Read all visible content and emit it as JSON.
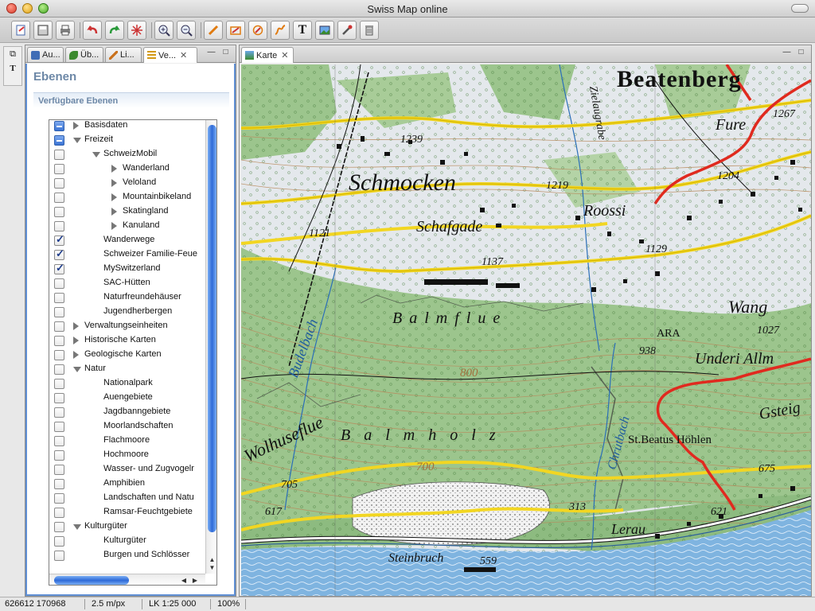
{
  "window": {
    "title": "Swiss Map online"
  },
  "toolbar": {
    "buttons": [
      {
        "name": "export-icon"
      },
      {
        "name": "save-icon"
      },
      {
        "name": "print-icon"
      },
      {
        "name": "undo-icon"
      },
      {
        "name": "redo-icon"
      },
      {
        "name": "center-icon"
      },
      {
        "name": "zoom-in-icon"
      },
      {
        "name": "zoom-out-icon"
      },
      {
        "name": "draw-line-icon"
      },
      {
        "name": "draw-polygon-icon"
      },
      {
        "name": "draw-circle-icon"
      },
      {
        "name": "draw-route-icon"
      },
      {
        "name": "text-icon"
      },
      {
        "name": "image-icon"
      },
      {
        "name": "tools-icon"
      },
      {
        "name": "trash-icon"
      }
    ],
    "text_button_label": "T"
  },
  "rail": {
    "icon1": "⧉",
    "icon2": "T"
  },
  "left_panel": {
    "tabs": [
      {
        "label": "Au...",
        "icon": "layers-tab-icon",
        "color": "#3f6db6"
      },
      {
        "label": "Üb...",
        "icon": "leaf-tab-icon",
        "color": "#3b8a2e"
      },
      {
        "label": "Li...",
        "icon": "pencil-tab-icon",
        "color": "#c9711c"
      },
      {
        "label": "Ve...",
        "icon": "list-tab-icon",
        "color": "#d39a16",
        "active": true
      }
    ],
    "close_glyph": "✕",
    "minimize_glyph": "—",
    "maximize_glyph": "□",
    "title": "Ebenen",
    "section": "Verfügbare Ebenen",
    "tree": [
      {
        "label": "Basisdaten",
        "level": 0,
        "check": "partial",
        "arrow": "right"
      },
      {
        "label": "Freizeit",
        "level": 0,
        "check": "partial",
        "arrow": "down"
      },
      {
        "label": "SchweizMobil",
        "level": 1,
        "check": "none",
        "arrow": "down"
      },
      {
        "label": "Wanderland",
        "level": 2,
        "check": "none",
        "arrow": "right"
      },
      {
        "label": "Veloland",
        "level": 2,
        "check": "none",
        "arrow": "right"
      },
      {
        "label": "Mountainbikeland",
        "level": 2,
        "check": "none",
        "arrow": "right"
      },
      {
        "label": "Skatingland",
        "level": 2,
        "check": "none",
        "arrow": "right"
      },
      {
        "label": "Kanuland",
        "level": 2,
        "check": "none",
        "arrow": "right"
      },
      {
        "label": "Wanderwege",
        "level": 1,
        "check": "checked",
        "arrow": ""
      },
      {
        "label": "Schweizer Familie-Feue",
        "level": 1,
        "check": "checked",
        "arrow": ""
      },
      {
        "label": "MySwitzerland",
        "level": 1,
        "check": "checked",
        "arrow": ""
      },
      {
        "label": "SAC-Hütten",
        "level": 1,
        "check": "none",
        "arrow": ""
      },
      {
        "label": "Naturfreundehäuser",
        "level": 1,
        "check": "none",
        "arrow": ""
      },
      {
        "label": "Jugendherbergen",
        "level": 1,
        "check": "none",
        "arrow": ""
      },
      {
        "label": "Verwaltungseinheiten",
        "level": 0,
        "check": "none",
        "arrow": "right"
      },
      {
        "label": "Historische Karten",
        "level": 0,
        "check": "none",
        "arrow": "right"
      },
      {
        "label": "Geologische Karten",
        "level": 0,
        "check": "none",
        "arrow": "right"
      },
      {
        "label": "Natur",
        "level": 0,
        "check": "none",
        "arrow": "down"
      },
      {
        "label": "Nationalpark",
        "level": 1,
        "check": "none",
        "arrow": ""
      },
      {
        "label": "Auengebiete",
        "level": 1,
        "check": "none",
        "arrow": ""
      },
      {
        "label": "Jagdbanngebiete",
        "level": 1,
        "check": "none",
        "arrow": ""
      },
      {
        "label": "Moorlandschaften",
        "level": 1,
        "check": "none",
        "arrow": ""
      },
      {
        "label": "Flachmoore",
        "level": 1,
        "check": "none",
        "arrow": ""
      },
      {
        "label": "Hochmoore",
        "level": 1,
        "check": "none",
        "arrow": ""
      },
      {
        "label": "Wasser- und Zugvogelr",
        "level": 1,
        "check": "none",
        "arrow": ""
      },
      {
        "label": "Amphibien",
        "level": 1,
        "check": "none",
        "arrow": ""
      },
      {
        "label": "Landschaften und Natu",
        "level": 1,
        "check": "none",
        "arrow": ""
      },
      {
        "label": "Ramsar-Feuchtgebiete",
        "level": 1,
        "check": "none",
        "arrow": ""
      },
      {
        "label": "Kulturgüter",
        "level": 0,
        "check": "none",
        "arrow": "down"
      },
      {
        "label": "Kulturgüter",
        "level": 1,
        "check": "none",
        "arrow": ""
      },
      {
        "label": "Burgen und Schlösser",
        "level": 1,
        "check": "none",
        "arrow": ""
      }
    ]
  },
  "map_panel": {
    "tab_label": "Karte",
    "place_labels": {
      "beatenberg": "Beatenberg",
      "schmocken": "Schmocken",
      "schafgade": "Schafgade",
      "roossi": "Roossi",
      "fure": "Fure",
      "wang": "Wang",
      "ara": "ARA",
      "balmflue": "B a l m f l u e",
      "balmholz": "B a l m h o l z",
      "wolhuseflue": "Wolhuseflue",
      "budelbach": "Budelbach",
      "chruttbach": "Chrutbach",
      "underi": "Underi Allm",
      "stbeatus": "St.Beatus Höhlen",
      "gsteig": "Gsteig",
      "lerau": "Lerau",
      "steinbruch": "Steinbruch",
      "grabe": "Zielaugrabe"
    },
    "elevations": {
      "e1239": "1239",
      "e1219": "1219",
      "e1121": "1121",
      "e1137": "1137",
      "e1129": "1129",
      "e1204": "1204",
      "e1267": "1267",
      "e1027": "1027",
      "e938": "938",
      "e800": "800",
      "e700": "700",
      "e705": "705",
      "e617": "617",
      "e313": "313",
      "e559": "559",
      "e621": "621",
      "e675": "675"
    },
    "colors": {
      "forest": "#9cc58d",
      "open": "#e6eaee",
      "lake": "#7fb4e0",
      "road": "#f2d622",
      "route": "#e02a1f",
      "contour": "#b98a5c"
    }
  },
  "status": {
    "coords": "626612 170968",
    "resolution": "2.5 m/px",
    "scale": "LK 1:25 000",
    "zoom": "100%"
  }
}
